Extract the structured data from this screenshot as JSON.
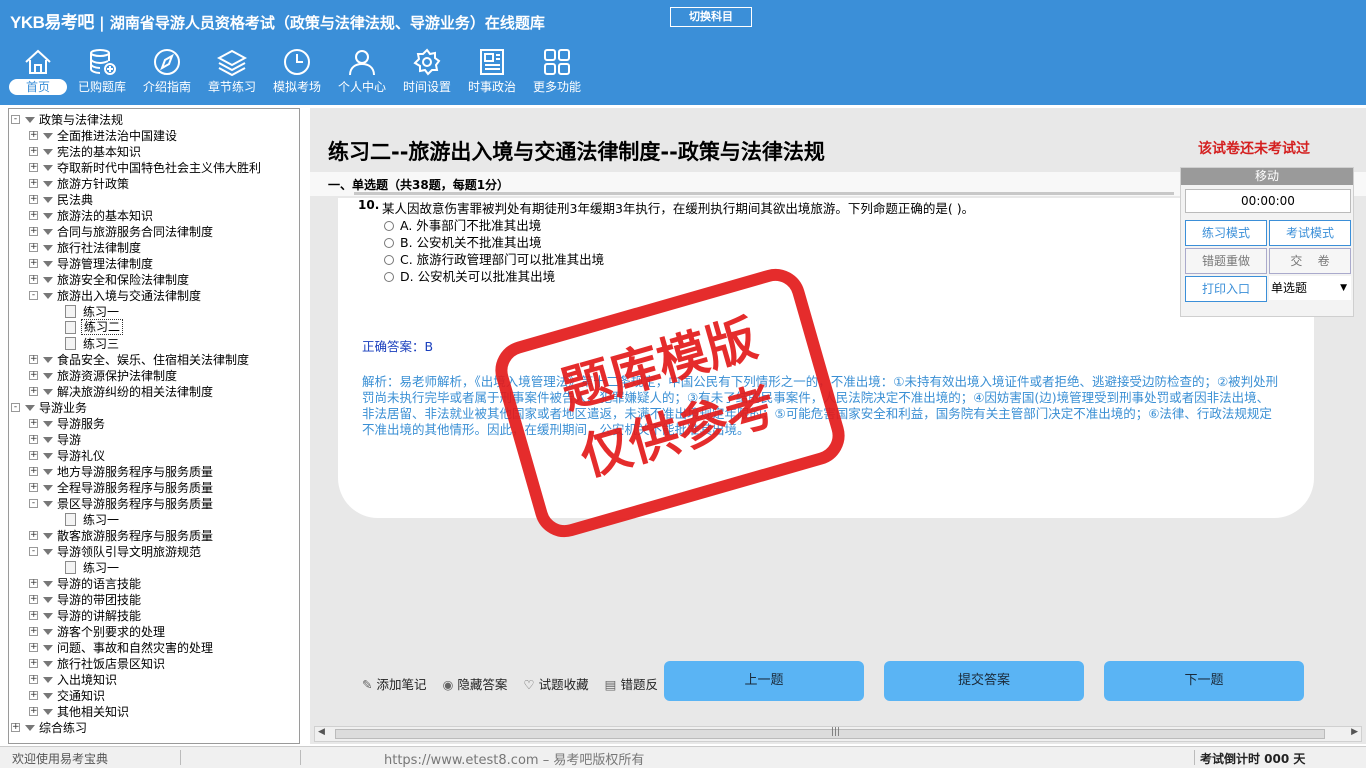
{
  "header": {
    "logo": "YKB易考吧",
    "title": "湖南省导游人员资格考试（政策与法律法规、导游业务）在线题库",
    "switch_label": "切换科目"
  },
  "nav": [
    {
      "label": "首页",
      "icon": "home-icon"
    },
    {
      "label": "已购题库",
      "icon": "database-icon"
    },
    {
      "label": "介绍指南",
      "icon": "compass-icon"
    },
    {
      "label": "章节练习",
      "icon": "layers-icon"
    },
    {
      "label": "模拟考场",
      "icon": "clock-icon"
    },
    {
      "label": "个人中心",
      "icon": "user-icon"
    },
    {
      "label": "时间设置",
      "icon": "gear-icon"
    },
    {
      "label": "时事政治",
      "icon": "news-icon"
    },
    {
      "label": "更多功能",
      "icon": "grid-icon"
    }
  ],
  "tree": [
    {
      "label": "政策与法律法规",
      "level": 0,
      "state": "-"
    },
    {
      "label": "全面推进法治中国建设",
      "level": 1,
      "state": "+"
    },
    {
      "label": "宪法的基本知识",
      "level": 1,
      "state": "+"
    },
    {
      "label": "夺取新时代中国特色社会主义伟大胜利",
      "level": 1,
      "state": "+"
    },
    {
      "label": "旅游方针政策",
      "level": 1,
      "state": "+"
    },
    {
      "label": "民法典",
      "level": 1,
      "state": "+"
    },
    {
      "label": "旅游法的基本知识",
      "level": 1,
      "state": "+"
    },
    {
      "label": "合同与旅游服务合同法律制度",
      "level": 1,
      "state": "+"
    },
    {
      "label": "旅行社法律制度",
      "level": 1,
      "state": "+"
    },
    {
      "label": "导游管理法律制度",
      "level": 1,
      "state": "+"
    },
    {
      "label": "旅游安全和保险法律制度",
      "level": 1,
      "state": "+"
    },
    {
      "label": "旅游出入境与交通法律制度",
      "level": 1,
      "state": "-"
    },
    {
      "label": "练习一",
      "level": 2,
      "state": "leaf"
    },
    {
      "label": "练习二",
      "level": 2,
      "state": "sel"
    },
    {
      "label": "练习三",
      "level": 2,
      "state": "leaf"
    },
    {
      "label": "食品安全、娱乐、住宿相关法律制度",
      "level": 1,
      "state": "+"
    },
    {
      "label": "旅游资源保护法律制度",
      "level": 1,
      "state": "+"
    },
    {
      "label": "解决旅游纠纷的相关法律制度",
      "level": 1,
      "state": "+"
    },
    {
      "label": "导游业务",
      "level": 0,
      "state": "-"
    },
    {
      "label": "导游服务",
      "level": 1,
      "state": "+"
    },
    {
      "label": "导游",
      "level": 1,
      "state": "+"
    },
    {
      "label": "导游礼仪",
      "level": 1,
      "state": "+"
    },
    {
      "label": "地方导游服务程序与服务质量",
      "level": 1,
      "state": "+"
    },
    {
      "label": "全程导游服务程序与服务质量",
      "level": 1,
      "state": "+"
    },
    {
      "label": "景区导游服务程序与服务质量",
      "level": 1,
      "state": "-"
    },
    {
      "label": "练习一",
      "level": 2,
      "state": "leaf"
    },
    {
      "label": "散客旅游服务程序与服务质量",
      "level": 1,
      "state": "+"
    },
    {
      "label": "导游领队引导文明旅游规范",
      "level": 1,
      "state": "-"
    },
    {
      "label": "练习一",
      "level": 2,
      "state": "leaf"
    },
    {
      "label": "导游的语言技能",
      "level": 1,
      "state": "+"
    },
    {
      "label": "导游的带团技能",
      "level": 1,
      "state": "+"
    },
    {
      "label": "导游的讲解技能",
      "level": 1,
      "state": "+"
    },
    {
      "label": "游客个别要求的处理",
      "level": 1,
      "state": "+"
    },
    {
      "label": "问题、事故和自然灾害的处理",
      "level": 1,
      "state": "+"
    },
    {
      "label": "旅行社饭店景区知识",
      "level": 1,
      "state": "+"
    },
    {
      "label": "入出境知识",
      "level": 1,
      "state": "+"
    },
    {
      "label": "交通知识",
      "level": 1,
      "state": "+"
    },
    {
      "label": "其他相关知识",
      "level": 1,
      "state": "+"
    },
    {
      "label": "综合练习",
      "level": 0,
      "state": "+"
    }
  ],
  "main": {
    "page_title": "练习二--旅游出入境与交通法律制度--政策与法律法规",
    "exam_status": "该试卷还未考试过",
    "section_title": "一、单选题（共38题，每题1分）",
    "question": {
      "number": "10.",
      "text": "某人因故意伤害罪被判处有期徒刑3年缓期3年执行，在缓刑执行期间其欲出境旅游。下列命题正确的是(  )。",
      "options": [
        "A. 外事部门不批准其出境",
        "B. 公安机关不批准其出境",
        "C. 旅游行政管理部门可以批准其出境",
        "D. 公安机关可以批准其出境"
      ]
    },
    "answer": "正确答案：B",
    "analysis": "解析：易老师解析，《出境入境管理法》第十二条规定，中国公民有下列情形之一的，不准出境：①未持有效出境入境证件或者拒绝、逃避接受边防检查的；②被判处刑罚尚未执行完毕或者属于刑事案件被告人、犯罪嫌疑人的；③有未了结的民事案件，人民法院决定不准出境的；④因妨害国(边)境管理受到刑事处罚或者因非法出境、非法居留、非法就业被其他国家或者地区遣返，未满不准出境规定年限的；⑤可能危害国家安全和利益，国务院有关主管部门决定不准出境的；⑥法律、行政法规规定不准出境的其他情形。因此，在缓刑期间，公安机关不能批准其出境。",
    "tools": [
      {
        "label": "添加笔记",
        "icon": "pencil-icon",
        "glyph": "✎"
      },
      {
        "label": "隐藏答案",
        "icon": "eye-icon",
        "glyph": "◉"
      },
      {
        "label": "试题收藏",
        "icon": "heart-icon",
        "glyph": "♡"
      },
      {
        "label": "错题反",
        "icon": "report-icon",
        "glyph": "▤"
      }
    ],
    "prev_label": "上一题",
    "submit_label": "提交答案",
    "next_label": "下一题"
  },
  "panel": {
    "move_label": "移动",
    "timer": "00:00:00",
    "practice_mode": "练习模式",
    "exam_mode": "考试模式",
    "redo_wrong": "错题重做",
    "hand_in": "交    卷",
    "print": "打印入口",
    "type_select": "单选题"
  },
  "watermark": {
    "line1": "题库模版",
    "line2": "仅供参考"
  },
  "status": {
    "welcome": "欢迎使用易考宝典",
    "url": "https://www.etest8.com – 易考吧版权所有",
    "countdown": "考试倒计时 000 天"
  },
  "colors": {
    "header_bg": "#3b8fd8",
    "stamp": "#e31b1b",
    "answer": "#1a3fbd",
    "analysis": "#3a8fd4",
    "nav_button": "#5ab4f4"
  }
}
